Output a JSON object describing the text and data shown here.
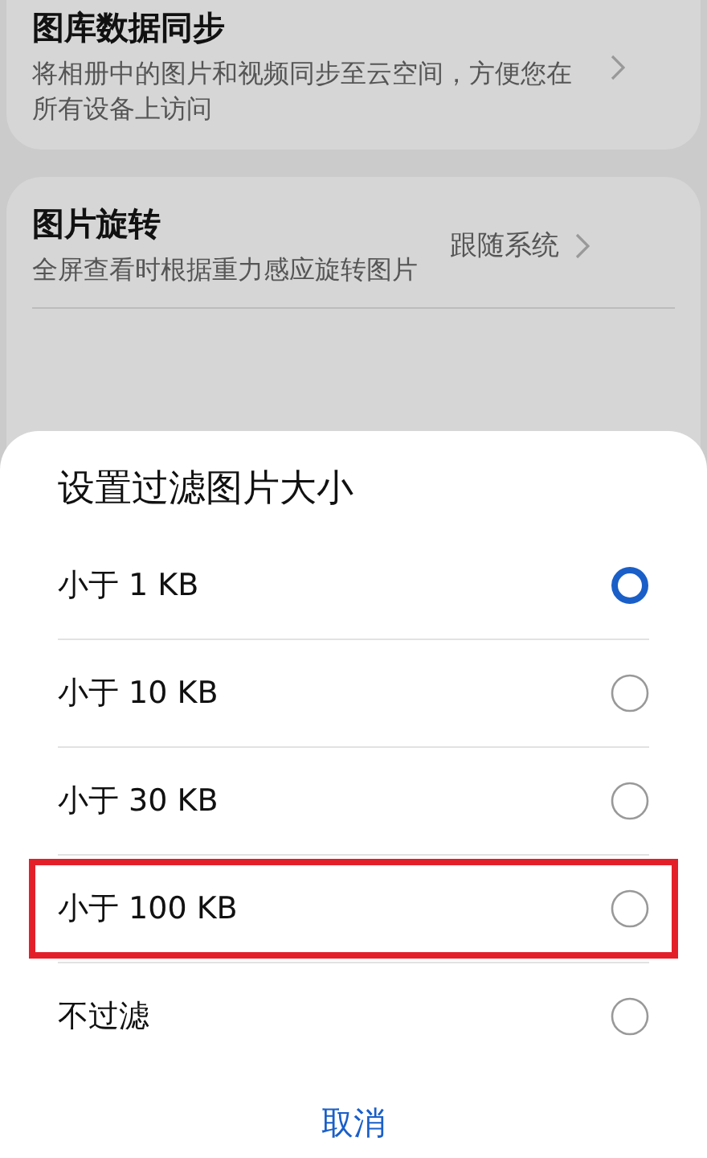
{
  "settings": [
    {
      "title": "图库数据同步",
      "description": "将相册中的图片和视频同步至云空间，方便您在所有设备上访问"
    },
    {
      "title": "图片旋转",
      "description": "全屏查看时根据重力感应旋转图片",
      "value": "跟随系统"
    }
  ],
  "dialog": {
    "title": "设置过滤图片大小",
    "options": [
      {
        "label": "小于 1 KB",
        "selected": true,
        "highlighted": false
      },
      {
        "label": "小于 10 KB",
        "selected": false,
        "highlighted": false
      },
      {
        "label": "小于 30 KB",
        "selected": false,
        "highlighted": false
      },
      {
        "label": "小于 100 KB",
        "selected": false,
        "highlighted": true
      },
      {
        "label": "不过滤",
        "selected": false,
        "highlighted": false
      }
    ],
    "cancel": "取消"
  }
}
